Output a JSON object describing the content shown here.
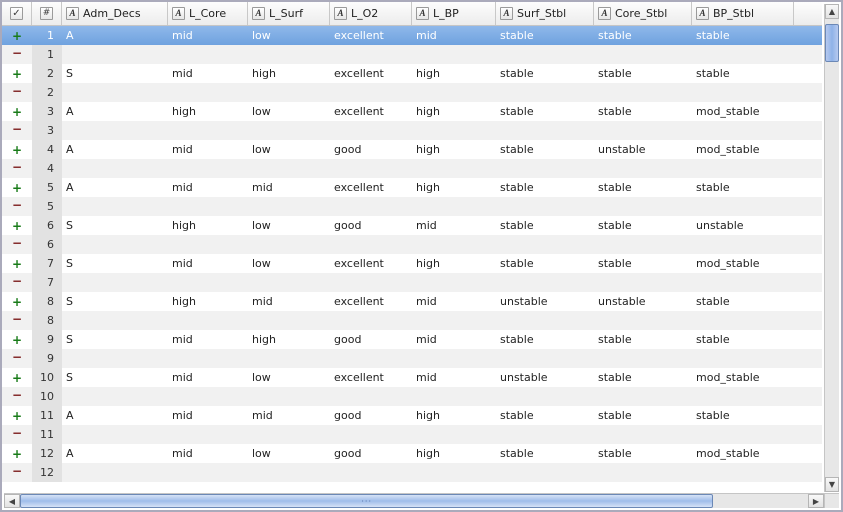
{
  "columns": [
    "Adm_Decs",
    "L_Core",
    "L_Surf",
    "L_O2",
    "L_BP",
    "Surf_Stbl",
    "Core_Stbl",
    "BP_Stbl"
  ],
  "mark_plus": "+",
  "mark_minus": "−",
  "selected_row_index": 0,
  "rows": [
    {
      "n": 1,
      "mark": "plus",
      "cells": [
        "A",
        "mid",
        "low",
        "excellent",
        "mid",
        "stable",
        "stable",
        "stable"
      ]
    },
    {
      "n": 1,
      "mark": "minus",
      "cells": [
        "",
        "",
        "",
        "",
        "",
        "",
        "",
        ""
      ]
    },
    {
      "n": 2,
      "mark": "plus",
      "cells": [
        "S",
        "mid",
        "high",
        "excellent",
        "high",
        "stable",
        "stable",
        "stable"
      ]
    },
    {
      "n": 2,
      "mark": "minus",
      "cells": [
        "",
        "",
        "",
        "",
        "",
        "",
        "",
        ""
      ]
    },
    {
      "n": 3,
      "mark": "plus",
      "cells": [
        "A",
        "high",
        "low",
        "excellent",
        "high",
        "stable",
        "stable",
        "mod_stable"
      ]
    },
    {
      "n": 3,
      "mark": "minus",
      "cells": [
        "",
        "",
        "",
        "",
        "",
        "",
        "",
        ""
      ]
    },
    {
      "n": 4,
      "mark": "plus",
      "cells": [
        "A",
        "mid",
        "low",
        "good",
        "high",
        "stable",
        "unstable",
        "mod_stable"
      ]
    },
    {
      "n": 4,
      "mark": "minus",
      "cells": [
        "",
        "",
        "",
        "",
        "",
        "",
        "",
        ""
      ]
    },
    {
      "n": 5,
      "mark": "plus",
      "cells": [
        "A",
        "mid",
        "mid",
        "excellent",
        "high",
        "stable",
        "stable",
        "stable"
      ]
    },
    {
      "n": 5,
      "mark": "minus",
      "cells": [
        "",
        "",
        "",
        "",
        "",
        "",
        "",
        ""
      ]
    },
    {
      "n": 6,
      "mark": "plus",
      "cells": [
        "S",
        "high",
        "low",
        "good",
        "mid",
        "stable",
        "stable",
        "unstable"
      ]
    },
    {
      "n": 6,
      "mark": "minus",
      "cells": [
        "",
        "",
        "",
        "",
        "",
        "",
        "",
        ""
      ]
    },
    {
      "n": 7,
      "mark": "plus",
      "cells": [
        "S",
        "mid",
        "low",
        "excellent",
        "high",
        "stable",
        "stable",
        "mod_stable"
      ]
    },
    {
      "n": 7,
      "mark": "minus",
      "cells": [
        "",
        "",
        "",
        "",
        "",
        "",
        "",
        ""
      ]
    },
    {
      "n": 8,
      "mark": "plus",
      "cells": [
        "S",
        "high",
        "mid",
        "excellent",
        "mid",
        "unstable",
        "unstable",
        "stable"
      ]
    },
    {
      "n": 8,
      "mark": "minus",
      "cells": [
        "",
        "",
        "",
        "",
        "",
        "",
        "",
        ""
      ]
    },
    {
      "n": 9,
      "mark": "plus",
      "cells": [
        "S",
        "mid",
        "high",
        "good",
        "mid",
        "stable",
        "stable",
        "stable"
      ]
    },
    {
      "n": 9,
      "mark": "minus",
      "cells": [
        "",
        "",
        "",
        "",
        "",
        "",
        "",
        ""
      ]
    },
    {
      "n": 10,
      "mark": "plus",
      "cells": [
        "S",
        "mid",
        "low",
        "excellent",
        "mid",
        "unstable",
        "stable",
        "mod_stable"
      ]
    },
    {
      "n": 10,
      "mark": "minus",
      "cells": [
        "",
        "",
        "",
        "",
        "",
        "",
        "",
        ""
      ]
    },
    {
      "n": 11,
      "mark": "plus",
      "cells": [
        "A",
        "mid",
        "mid",
        "good",
        "high",
        "stable",
        "stable",
        "stable"
      ]
    },
    {
      "n": 11,
      "mark": "minus",
      "cells": [
        "",
        "",
        "",
        "",
        "",
        "",
        "",
        ""
      ]
    },
    {
      "n": 12,
      "mark": "plus",
      "cells": [
        "A",
        "mid",
        "low",
        "good",
        "high",
        "stable",
        "stable",
        "mod_stable"
      ]
    },
    {
      "n": 12,
      "mark": "minus",
      "cells": [
        "",
        "",
        "",
        "",
        "",
        "",
        "",
        ""
      ]
    }
  ]
}
